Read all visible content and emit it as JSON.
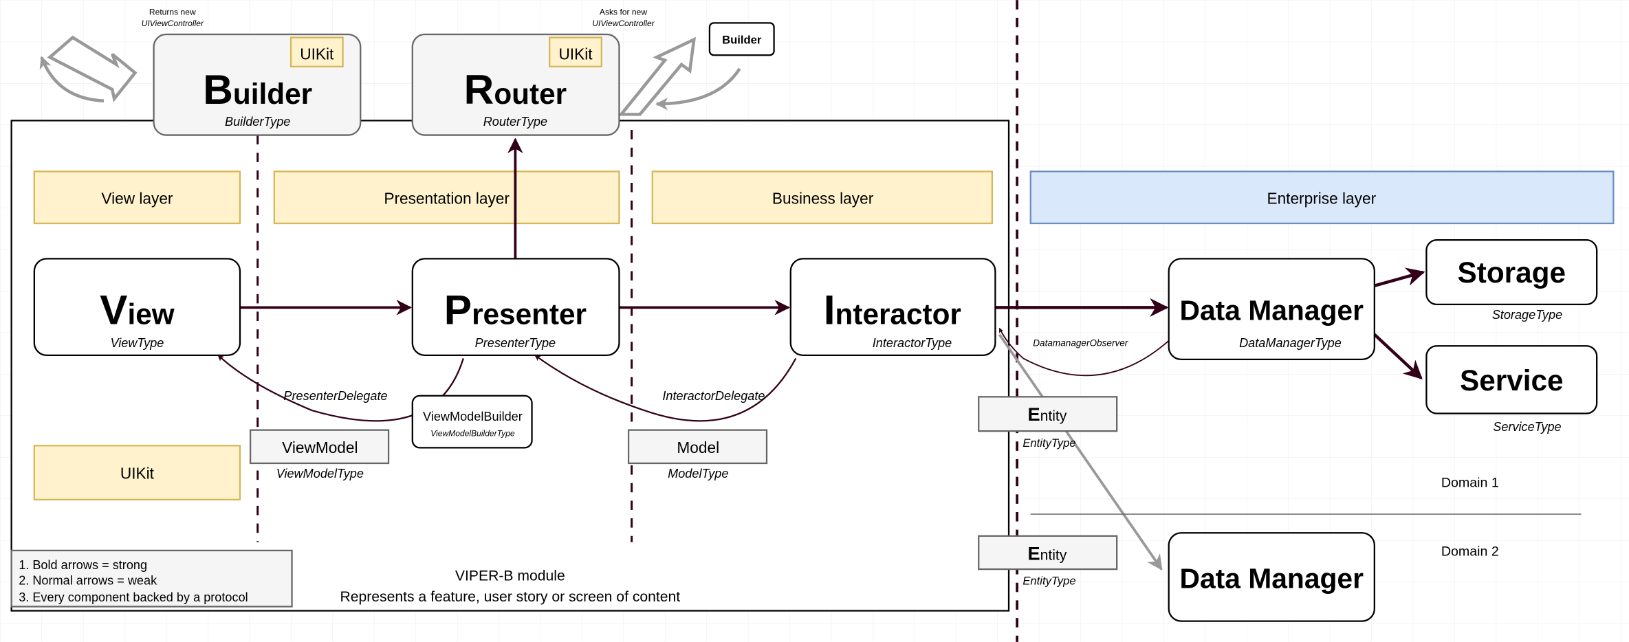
{
  "colors": {
    "strong_arrow": "#33001a",
    "weak_arrow": "#999999",
    "layer_fill": "#fff2cc",
    "layer_stroke": "#d6b656",
    "enterprise_fill": "#dae8fc",
    "enterprise_stroke": "#6c8ebf",
    "component_fill": "#f5f5f5"
  },
  "notes": {
    "returns_1": "Returns new",
    "returns_2": "UIViewController",
    "asks_1": "Asks for new",
    "asks_2": "UIViewController"
  },
  "builder": {
    "initial": "B",
    "rest": "uilder",
    "type": "BuilderType",
    "badge": "UIKit"
  },
  "router": {
    "initial": "R",
    "rest": "outer",
    "type": "RouterType",
    "badge": "UIKit"
  },
  "external_builder": "Builder",
  "layers": {
    "view": "View layer",
    "presentation": "Presentation layer",
    "business": "Business layer",
    "enterprise": "Enterprise layer",
    "uikit": "UIKit"
  },
  "view": {
    "initial": "V",
    "rest": "iew",
    "type": "ViewType"
  },
  "presenter": {
    "initial": "P",
    "rest": "resenter",
    "type": "PresenterType"
  },
  "interactor": {
    "initial": "I",
    "rest": "nteractor",
    "type": "InteractorType"
  },
  "edges": {
    "presenter_delegate": "PresenterDelegate",
    "interactor_delegate": "InteractorDelegate",
    "datamanager_observer": "DatamanagerObserver"
  },
  "view_model_builder": {
    "name": "ViewModelBuilder",
    "type": "ViewModelBuilderType"
  },
  "view_model": {
    "name": "ViewModel",
    "type": "ViewModelType"
  },
  "model": {
    "name": "Model",
    "type": "ModelType"
  },
  "entity1": {
    "initial": "E",
    "rest": "ntity",
    "type": "EntityType"
  },
  "entity2": {
    "initial": "E",
    "rest": "ntity",
    "type": "EntityType"
  },
  "data_manager": {
    "name": "Data Manager",
    "type": "DataManagerType"
  },
  "data_manager2": {
    "name": "Data Manager"
  },
  "storage": {
    "name": "Storage",
    "type": "StorageType"
  },
  "service": {
    "name": "Service",
    "type": "ServiceType"
  },
  "domains": {
    "d1": "Domain 1",
    "d2": "Domain 2"
  },
  "legend": [
    "1. Bold arrows = strong",
    "2. Normal arrows = weak",
    "3. Every component backed by a protocol"
  ],
  "module": {
    "title": "VIPER-B module",
    "subtitle": "Represents a feature, user story or screen of content"
  }
}
